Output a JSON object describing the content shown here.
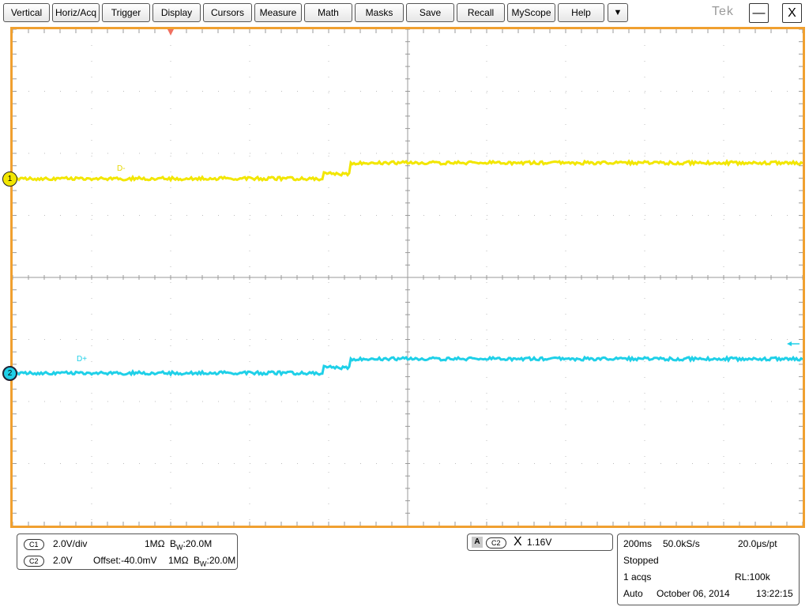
{
  "menu": {
    "items": [
      "Vertical",
      "Horiz/Acq",
      "Trigger",
      "Display",
      "Cursors",
      "Measure",
      "Math",
      "Masks",
      "Save",
      "Recall",
      "MyScope",
      "Help"
    ],
    "dropdown_glyph": "▼",
    "brand": "Tek",
    "minimize_glyph": "—",
    "close_glyph": "X"
  },
  "colors": {
    "ch1": "#f2e600",
    "ch2": "#1fd0e8",
    "frame": "#f0a030",
    "trigger_marker": "#f07060"
  },
  "channels": {
    "ch1": {
      "number": "1",
      "label": "D-"
    },
    "ch2": {
      "number": "2",
      "label": "D+"
    }
  },
  "vertical_panel": {
    "c1_tag": "C1",
    "c1_scale": "2.0V/div",
    "c1_coupling": "1MΩ",
    "c1_bw_prefix": "B",
    "c1_bw_sub": "W",
    "c1_bw": ":20.0M",
    "c2_tag": "C2",
    "c2_scale": "2.0V",
    "c2_offset": "Offset:-40.0mV",
    "c2_coupling": "1MΩ",
    "c2_bw_prefix": "B",
    "c2_bw_sub": "W",
    "c2_bw": ":20.0M"
  },
  "trigger_panel": {
    "mode": "A",
    "source": "C2",
    "slope_glyph": "X",
    "level": "1.16V"
  },
  "acq_panel": {
    "timebase": "200ms",
    "sample_rate": "50.0kS/s",
    "per_point": "20.0μs/pt",
    "state": "Stopped",
    "acqs": "1 acqs",
    "record_length": "RL:100k",
    "trigger_mode": "Auto",
    "date": "October 06, 2014",
    "time": "13:22:15"
  }
}
